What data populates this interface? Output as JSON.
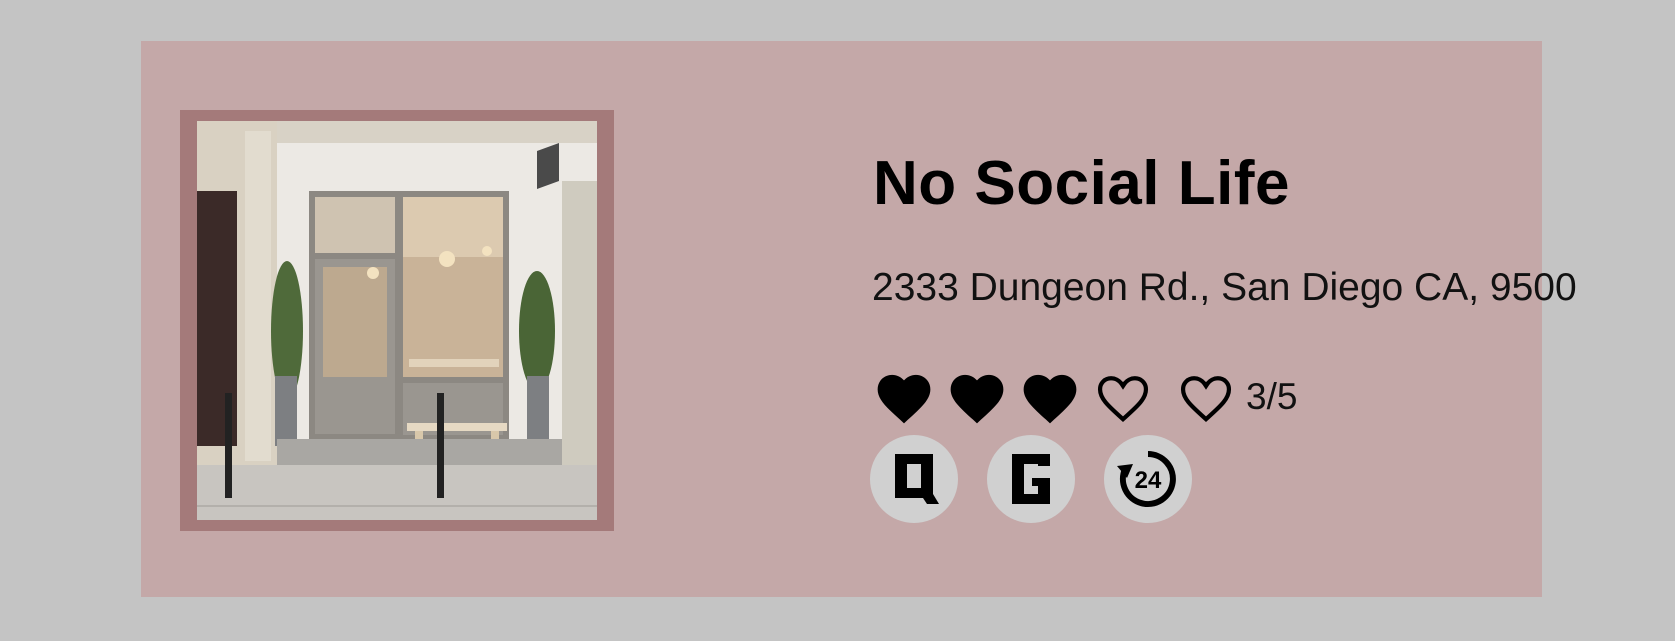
{
  "restaurant": {
    "name": "No Social Life",
    "address": "2333 Dungeon Rd., San Diego CA, 9500",
    "photo_icon": "storefront-photo",
    "rating": {
      "value": 3,
      "max": 5,
      "label": "3/5",
      "icon": "heart-icon"
    },
    "badges": [
      {
        "icon": "q-badge-icon",
        "letter": "Q"
      },
      {
        "icon": "g-badge-icon",
        "letter": "G"
      },
      {
        "icon": "24-hours-icon",
        "text": "24"
      }
    ]
  },
  "colors": {
    "page_background": "#c4c4c4",
    "card_background": "#c4a8a8",
    "photo_frame": "#a47a7a",
    "badge_background": "#d0d0d0",
    "heart": "#000000"
  }
}
